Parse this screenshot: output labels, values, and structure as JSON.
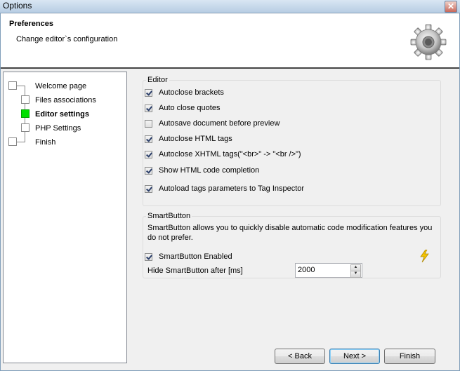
{
  "window": {
    "title": "Options",
    "close_glyph": "✕"
  },
  "header": {
    "title": "Preferences",
    "subtitle": "Change editor`s configuration",
    "icon": "gear-icon"
  },
  "nav": {
    "items": [
      {
        "label": "Welcome page"
      },
      {
        "label": "Files associations"
      },
      {
        "label": "Editor settings",
        "active": true
      },
      {
        "label": "PHP Settings"
      },
      {
        "label": "Finish"
      }
    ]
  },
  "editor": {
    "legend": "Editor",
    "options": [
      {
        "label": "Autoclose brackets",
        "checked": true
      },
      {
        "label": "Auto close quotes",
        "checked": true
      },
      {
        "label": "Autosave document before preview",
        "checked": false
      },
      {
        "label": "Autoclose HTML tags",
        "checked": true
      },
      {
        "label": "Autoclose XHTML tags(\"<br>\" -> \"<br />\")",
        "checked": true
      },
      {
        "label": "Show HTML code completion",
        "checked": true
      },
      {
        "label": "Autoload tags parameters to Tag Inspector",
        "checked": true
      }
    ]
  },
  "smartbutton": {
    "legend": "SmartButton",
    "description": "SmartButton allows you to quickly disable automatic code modification features you do not prefer.",
    "enabled_label": "SmartButton Enabled",
    "enabled": true,
    "hide_label": "Hide SmartButton after [ms]",
    "hide_value": "2000",
    "icon": "lightning-icon"
  },
  "buttons": {
    "back": "< Back",
    "next": "Next >",
    "finish": "Finish"
  },
  "colors": {
    "active_node": "#00e000",
    "bolt": "#f5c400"
  }
}
